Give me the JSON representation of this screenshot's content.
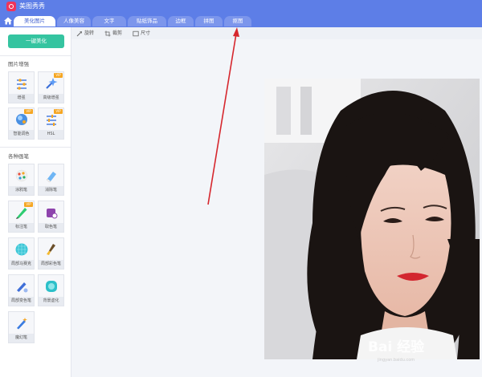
{
  "app": {
    "title": "美图秀秀"
  },
  "tabs": [
    {
      "label": "美化图片",
      "active": true
    },
    {
      "label": "人像美容",
      "active": false
    },
    {
      "label": "文字",
      "active": false
    },
    {
      "label": "贴纸饰品",
      "active": false
    },
    {
      "label": "边框",
      "active": false
    },
    {
      "label": "拼图",
      "active": false
    },
    {
      "label": "抠图",
      "active": false
    }
  ],
  "toolbar": {
    "rotate_label": "旋转",
    "crop_label": "裁剪",
    "size_label": "尺寸"
  },
  "sidebar": {
    "one_key_label": "一键美化",
    "enhance_title": "图片增强",
    "enhance_tools": [
      {
        "label": "增强",
        "icon": "sliders-icon",
        "vip": false
      },
      {
        "label": "高级增强",
        "icon": "magic-wand-icon",
        "vip": true
      },
      {
        "label": "智能调色",
        "icon": "color-ball-icon",
        "vip": true
      },
      {
        "label": "HSL",
        "icon": "hsl-sliders-icon",
        "vip": true
      }
    ],
    "brush_title": "各种画笔",
    "brush_tools": [
      {
        "label": "涂鸦笔",
        "icon": "doodle-pen-icon",
        "vip": false
      },
      {
        "label": "消除笔",
        "icon": "eraser-icon",
        "vip": false
      },
      {
        "label": "标注笔",
        "icon": "marker-pen-icon",
        "vip": true
      },
      {
        "label": "取色笔",
        "icon": "color-picker-icon",
        "vip": false
      },
      {
        "label": "局部马赛克",
        "icon": "mosaic-icon",
        "vip": false
      },
      {
        "label": "局部彩色笔",
        "icon": "color-brush-icon",
        "vip": false
      },
      {
        "label": "局部变色笔",
        "icon": "recolor-brush-icon",
        "vip": false
      },
      {
        "label": "背景虚化",
        "icon": "blur-background-icon",
        "vip": false
      },
      {
        "label": "魔幻笔",
        "icon": "magic-pen-icon",
        "vip": false
      }
    ],
    "vip_label": "VIP"
  },
  "watermark": {
    "text": "Bai 经验",
    "sub": "jingyan.baidu.com"
  },
  "colors": {
    "topbar": "#5d7ee7",
    "accent_green": "#35c4a0",
    "vip": "#f5a623",
    "arrow": "#d6272e"
  }
}
